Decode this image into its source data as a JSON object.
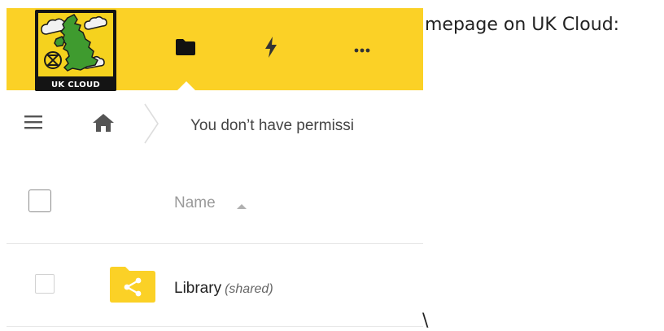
{
  "app": {
    "logo_text": "UK CLOUD",
    "nav": [
      {
        "icon": "folder-icon",
        "label": "Files"
      },
      {
        "icon": "lightning-icon",
        "label": "Activity"
      },
      {
        "icon": "more-icon",
        "label": "More"
      }
    ],
    "accent_color": "#fbd126"
  },
  "caption": "mepage on UK Cloud:",
  "controls": {
    "notice": "You don’t have permissi"
  },
  "list": {
    "column_name": "Name",
    "sort": "ascending",
    "rows": [
      {
        "name": "Library",
        "tag": "(shared)",
        "type": "shared-folder",
        "checked": false
      }
    ]
  },
  "stray_mark": "\\"
}
